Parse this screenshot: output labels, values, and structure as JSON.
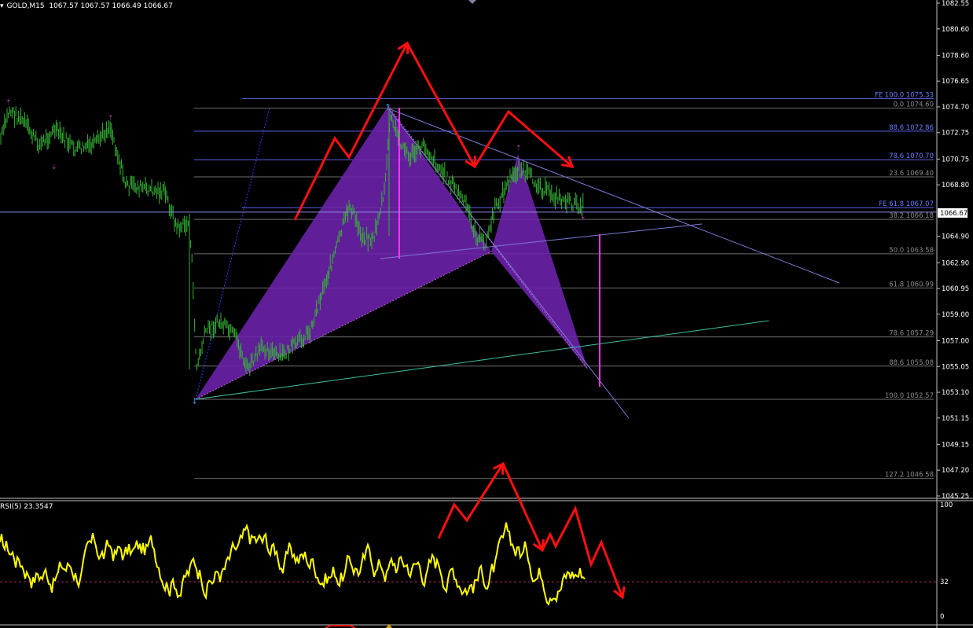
{
  "header": {
    "symbol": "GOLD,M15",
    "open": "1067.57",
    "high": "1067.57",
    "low": "1066.49",
    "close": "1066.67"
  },
  "rsi": {
    "label": "RSI(5) 23.3547",
    "axis": [
      "100",
      "32",
      "0"
    ],
    "level_value": 32
  },
  "price_axis": [
    "1082.55",
    "1080.60",
    "1078.60",
    "1076.65",
    "1074.70",
    "1072.75",
    "1070.75",
    "1068.80",
    "1064.90",
    "1062.90",
    "1060.95",
    "1059.00",
    "1057.00",
    "1055.05",
    "1053.10",
    "1051.15",
    "1049.15",
    "1047.20",
    "1045.25"
  ],
  "current_price": "1066.67",
  "fib_levels": [
    {
      "text": "FE 100.0 1075.33",
      "color": "#6a7bff"
    },
    {
      "text": "0.0  1074.60",
      "color": "#8a8a8a"
    },
    {
      "text": "88.6 1072.86",
      "color": "#6a7bff"
    },
    {
      "text": "78.6 1070.70",
      "color": "#6a7bff"
    },
    {
      "text": "23.6  1069.40",
      "color": "#8a8a8a"
    },
    {
      "text": "FE 61.8 1067.07",
      "color": "#6a7bff"
    },
    {
      "text": "38.2  1066.18",
      "color": "#8a8a8a"
    },
    {
      "text": "50.0  1063.58",
      "color": "#8a8a8a"
    },
    {
      "text": "61.8  1060.99",
      "color": "#8a8a8a"
    },
    {
      "text": "78.6  1057.29",
      "color": "#8a8a8a"
    },
    {
      "text": "88.6  1055.08",
      "color": "#8a8a8a"
    },
    {
      "text": "100.0  1052.57",
      "color": "#8a8a8a"
    },
    {
      "text": "127.2  1046.58",
      "color": "#8a8a8a"
    }
  ],
  "colors": {
    "background": "#000000",
    "candles": "#35b535",
    "pattern_fill": "#6a22a8",
    "annotation_arrows": "#ff1010",
    "rsi_line": "#ffff00",
    "fib_blue": "#5a64e6",
    "fib_gray": "#6e6e6e",
    "trendline": "#7b7bd6",
    "support_line": "#40c0a0",
    "magenta": "#ff33ff"
  }
}
